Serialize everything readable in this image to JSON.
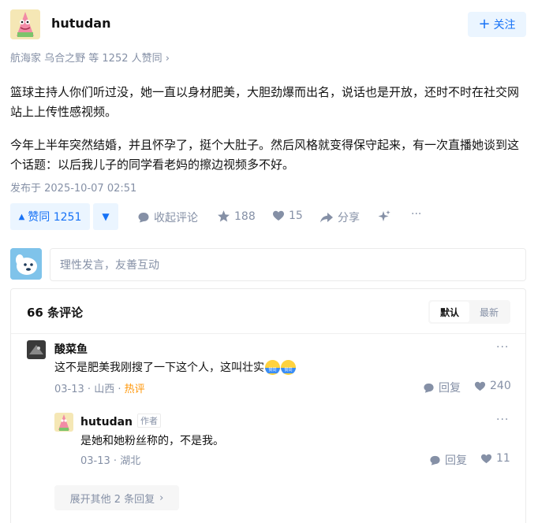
{
  "author": {
    "name": "hutudan"
  },
  "follow_label": "关注",
  "upvoters": "航海家 乌合之野 等 1252 人赞同",
  "content": {
    "p1": "篮球主持人你们听过没，她一直以身材肥美，大胆劲爆而出名，说话也是开放，还时不时在社交网站上上传性感视频。",
    "p2": "今年上半年突然结婚，并且怀孕了，挺个大肚子。然后风格就变得保守起来，有一次直播她谈到这个话题：以后我儿子的同学看老妈的擦边视频多不好。"
  },
  "publish_time": "发布于 2025-10-07 02:51",
  "actions": {
    "upvote": "赞同 1251",
    "collapse_comments": "收起评论",
    "favorites": "188",
    "likes": "15",
    "share": "分享"
  },
  "comment_input": {
    "placeholder": "理性发言，友善互动"
  },
  "comments": {
    "count_label": "66 条评论",
    "sort": {
      "default": "默认",
      "latest": "最新"
    },
    "items": [
      {
        "name": "酸菜鱼",
        "text": "这不是肥美我刚搜了一下这个人，这叫壮实",
        "date": "03-13",
        "location": "山西",
        "hot": "热评",
        "reply_label": "回复",
        "likes": "240",
        "emoji_label": "赞同"
      },
      {
        "name": "hutudan",
        "author_tag": "作者",
        "text": "是她和她粉丝称的，不是我。",
        "date": "03-13",
        "location": "湖北",
        "reply_label": "回复",
        "likes": "11"
      }
    ],
    "expand_label": "展开其他 2 条回复"
  },
  "colors": {
    "accent": "#1772f6",
    "muted": "#8590a6",
    "hot": "#ff9607"
  }
}
